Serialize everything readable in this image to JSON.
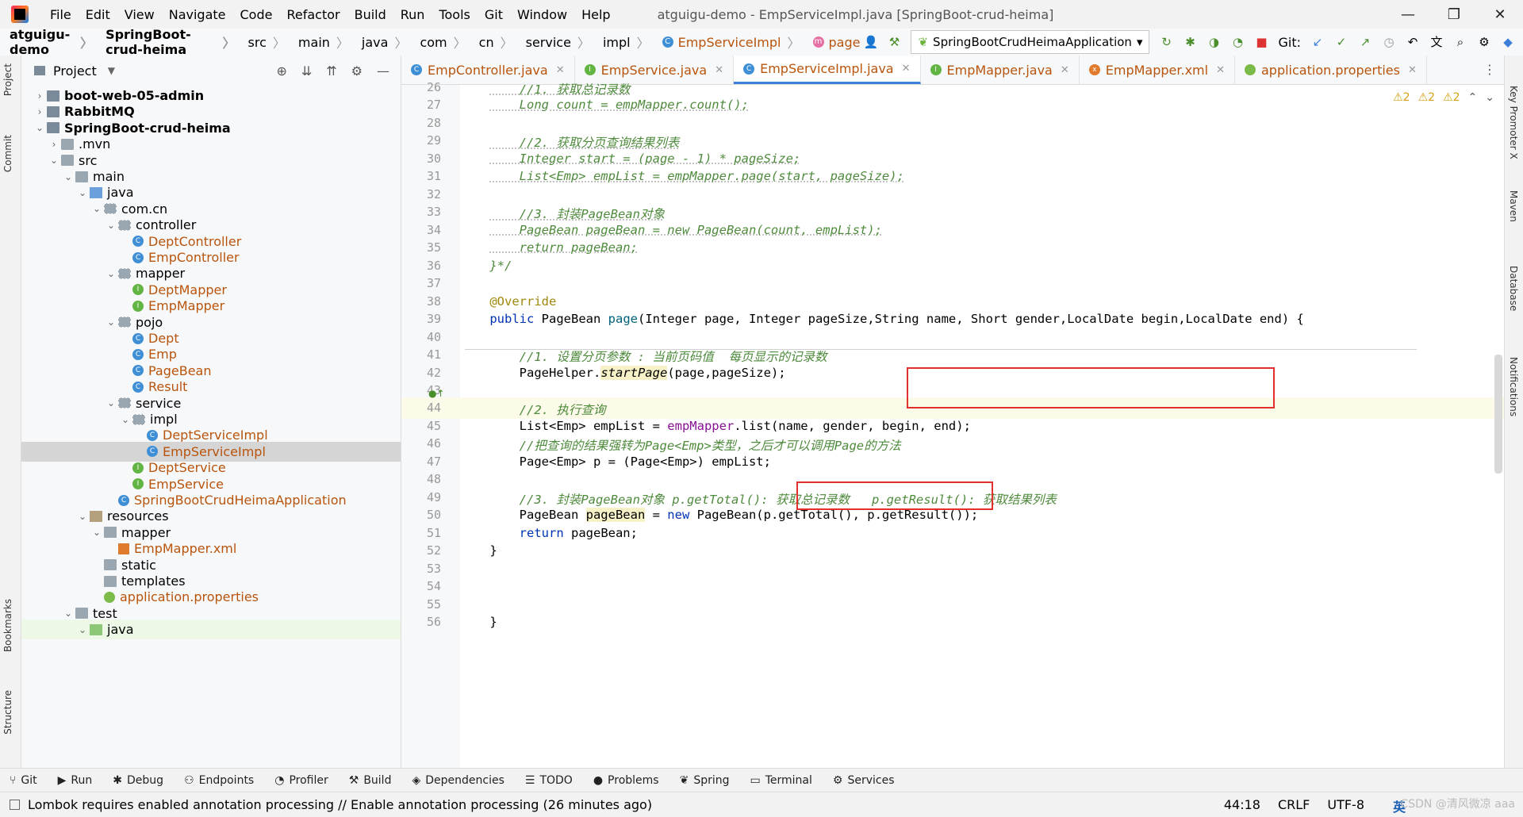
{
  "window": {
    "menu": [
      "File",
      "Edit",
      "View",
      "Navigate",
      "Code",
      "Refactor",
      "Build",
      "Run",
      "Tools",
      "Git",
      "Window",
      "Help"
    ],
    "title": "atguigu-demo - EmpServiceImpl.java [SpringBoot-crud-heima]",
    "controls": {
      "minimize": "—",
      "maximize": "❐",
      "close": "✕"
    }
  },
  "breadcrumbs": [
    "atguigu-demo",
    "SpringBoot-crud-heima",
    "src",
    "main",
    "java",
    "com",
    "cn",
    "service",
    "impl",
    "EmpServiceImpl",
    "page"
  ],
  "run_config": "SpringBootCrudHeimaApplication",
  "git_label": "Git:",
  "sidebars": {
    "left": [
      "Project",
      "Commit",
      "Bookmarks",
      "Structure"
    ],
    "right": [
      "Key Promoter X",
      "Maven",
      "Database",
      "Notifications"
    ]
  },
  "project_panel": {
    "title": "Project",
    "tree": [
      {
        "label": "boot-web-05-admin",
        "arrow": "›",
        "icon": "mod",
        "bold": true,
        "depth": 1
      },
      {
        "label": "RabbitMQ",
        "arrow": "›",
        "icon": "mod",
        "bold": true,
        "depth": 1
      },
      {
        "label": "SpringBoot-crud-heima",
        "arrow": "⌄",
        "icon": "mod",
        "bold": true,
        "depth": 1
      },
      {
        "label": ".mvn",
        "arrow": "›",
        "icon": "folder",
        "depth": 2
      },
      {
        "label": "src",
        "arrow": "⌄",
        "icon": "folder",
        "depth": 2
      },
      {
        "label": "main",
        "arrow": "⌄",
        "icon": "folder",
        "depth": 3
      },
      {
        "label": "java",
        "arrow": "⌄",
        "icon": "src",
        "depth": 4
      },
      {
        "label": "com.cn",
        "arrow": "⌄",
        "icon": "pkg",
        "depth": 5
      },
      {
        "label": "controller",
        "arrow": "⌄",
        "icon": "pkg",
        "depth": 6
      },
      {
        "label": "DeptController",
        "icon": "cls",
        "orange": true,
        "depth": 7
      },
      {
        "label": "EmpController",
        "icon": "cls",
        "orange": true,
        "depth": 7
      },
      {
        "label": "mapper",
        "arrow": "⌄",
        "icon": "pkg",
        "depth": 6
      },
      {
        "label": "DeptMapper",
        "icon": "intf",
        "orange": true,
        "depth": 7
      },
      {
        "label": "EmpMapper",
        "icon": "intf",
        "orange": true,
        "depth": 7
      },
      {
        "label": "pojo",
        "arrow": "⌄",
        "icon": "pkg",
        "depth": 6
      },
      {
        "label": "Dept",
        "icon": "cls",
        "orange": true,
        "depth": 7
      },
      {
        "label": "Emp",
        "icon": "cls",
        "orange": true,
        "depth": 7
      },
      {
        "label": "PageBean",
        "icon": "cls",
        "orange": true,
        "depth": 7
      },
      {
        "label": "Result",
        "icon": "cls",
        "orange": true,
        "depth": 7
      },
      {
        "label": "service",
        "arrow": "⌄",
        "icon": "pkg",
        "depth": 6
      },
      {
        "label": "impl",
        "arrow": "⌄",
        "icon": "pkg",
        "depth": 7
      },
      {
        "label": "DeptServiceImpl",
        "icon": "cls",
        "orange": true,
        "depth": 8
      },
      {
        "label": "EmpServiceImpl",
        "icon": "cls",
        "orange": true,
        "depth": 8,
        "selected": true
      },
      {
        "label": "DeptService",
        "icon": "intf",
        "orange": true,
        "depth": 7
      },
      {
        "label": "EmpService",
        "icon": "intf",
        "orange": true,
        "depth": 7
      },
      {
        "label": "SpringBootCrudHeimaApplication",
        "icon": "cls",
        "orange": true,
        "depth": 6
      },
      {
        "label": "resources",
        "arrow": "⌄",
        "icon": "res",
        "depth": 4
      },
      {
        "label": "mapper",
        "arrow": "⌄",
        "icon": "folder",
        "depth": 5
      },
      {
        "label": "EmpMapper.xml",
        "icon": "xml",
        "orange": true,
        "depth": 6
      },
      {
        "label": "static",
        "icon": "folder",
        "depth": 5
      },
      {
        "label": "templates",
        "icon": "folder",
        "depth": 5
      },
      {
        "label": "application.properties",
        "icon": "prop",
        "orange": true,
        "depth": 5
      },
      {
        "label": "test",
        "arrow": "⌄",
        "icon": "folder",
        "depth": 3
      },
      {
        "label": "java",
        "arrow": "⌄",
        "icon": "test",
        "depth": 4,
        "green": true
      }
    ]
  },
  "editor_tabs": [
    {
      "label": "EmpController.java",
      "icon": "C",
      "color": "#3f8fd7"
    },
    {
      "label": "EmpService.java",
      "icon": "I",
      "color": "#62b543"
    },
    {
      "label": "EmpServiceImpl.java",
      "icon": "C",
      "color": "#3f8fd7",
      "active": true
    },
    {
      "label": "EmpMapper.java",
      "icon": "I",
      "color": "#62b543"
    },
    {
      "label": "EmpMapper.xml",
      "icon": "x",
      "color": "#e07a2c"
    },
    {
      "label": "application.properties",
      "icon": "",
      "color": "#7cba4a"
    }
  ],
  "inspections": {
    "w1": "⚠2",
    "w2": "⚠2",
    "w3": "⚠2"
  },
  "code_lines": [
    {
      "n": "26",
      "html": "<span class='cmx'>    //1. 获取总记录数</span>"
    },
    {
      "n": "27",
      "html": "<span class='cmx'>    Long count = empMapper.count();</span>"
    },
    {
      "n": "28",
      "html": ""
    },
    {
      "n": "29",
      "html": "<span class='cmx'>    //2. 获取分页查询结果列表</span>"
    },
    {
      "n": "30",
      "html": "<span class='cmx'>    Integer start = (page - 1) * pageSize;</span>"
    },
    {
      "n": "31",
      "html": "<span class='cmx'>    List&lt;Emp&gt; empList = empMapper.page(start, pageSize);</span>"
    },
    {
      "n": "32",
      "html": ""
    },
    {
      "n": "33",
      "html": "<span class='cmx'>    //3. 封装PageBean对象</span>"
    },
    {
      "n": "34",
      "html": "<span class='cmx'>    PageBean pageBean = new PageBean(count, empList);</span>"
    },
    {
      "n": "35",
      "html": "<span class='cmx'>    return pageBean;</span>"
    },
    {
      "n": "36",
      "html": "<span class='cm'>}*/</span>"
    },
    {
      "n": "37",
      "html": ""
    },
    {
      "n": "38",
      "html": "<span class='ann'>@Override</span>"
    },
    {
      "n": "39",
      "html": "<span class='kw'>public</span> PageBean <span class='fn'>page</span>(Integer page, Integer pageSize,String name, Short gender,LocalDate begin,LocalDate end) {"
    },
    {
      "n": "40",
      "html": ""
    },
    {
      "n": "41",
      "html": "<span class='cm'>    //1. 设置分页参数 : 当前页码值  每页显示的记录数</span>"
    },
    {
      "n": "42",
      "html": "    PageHelper.<span class='hl-word' style='font-style:italic'>startPage</span>(page,pageSize);"
    },
    {
      "n": "43",
      "html": ""
    },
    {
      "n": "44",
      "html": "<span class='cm'>    //2. 执行查询</span>",
      "hl": true
    },
    {
      "n": "45",
      "html": "    List&lt;Emp&gt; empList = <span class='fld'>empMapper</span>.list(name, gender, begin, end);"
    },
    {
      "n": "46",
      "html": "<span class='cm'>    //把查询的结果强转为Page&lt;Emp&gt;类型，之后才可以调用Page的方法</span>"
    },
    {
      "n": "47",
      "html": "    Page&lt;Emp&gt; p = (Page&lt;Emp&gt;) empList;"
    },
    {
      "n": "48",
      "html": ""
    },
    {
      "n": "49",
      "html": "<span class='cm'>    //3. 封装PageBean对象 p.getTotal(): 获取总记录数   p.getResult(): 获取结果列表</span>"
    },
    {
      "n": "50",
      "html": "    PageBean <span class='hl-word'>pageBean</span> = <span class='kw'>new</span> PageBean(p.getTotal(), p.getResult());"
    },
    {
      "n": "51",
      "html": "    <span class='kw'>return</span> pageBean;"
    },
    {
      "n": "52",
      "html": "}"
    },
    {
      "n": "53",
      "html": ""
    },
    {
      "n": "54",
      "html": ""
    },
    {
      "n": "55",
      "html": ""
    },
    {
      "n": "56",
      "html": "}"
    }
  ],
  "bottom_tools": [
    {
      "label": "Git",
      "icon": "⑂"
    },
    {
      "label": "Run",
      "icon": "▶"
    },
    {
      "label": "Debug",
      "icon": "✱"
    },
    {
      "label": "Endpoints",
      "icon": "⚇"
    },
    {
      "label": "Profiler",
      "icon": "◔"
    },
    {
      "label": "Build",
      "icon": "⚒"
    },
    {
      "label": "Dependencies",
      "icon": "◈"
    },
    {
      "label": "TODO",
      "icon": "☰"
    },
    {
      "label": "Problems",
      "icon": "●"
    },
    {
      "label": "Spring",
      "icon": "❦"
    },
    {
      "label": "Terminal",
      "icon": "▭"
    },
    {
      "label": "Services",
      "icon": "⚙"
    }
  ],
  "status": {
    "message": "Lombok requires enabled annotation processing // Enable annotation processing (26 minutes ago)",
    "position": "44:18",
    "line_sep": "CRLF",
    "encoding": "UTF-8",
    "watermark": "CSDN @清风微凉 aaa",
    "ime": "英"
  }
}
